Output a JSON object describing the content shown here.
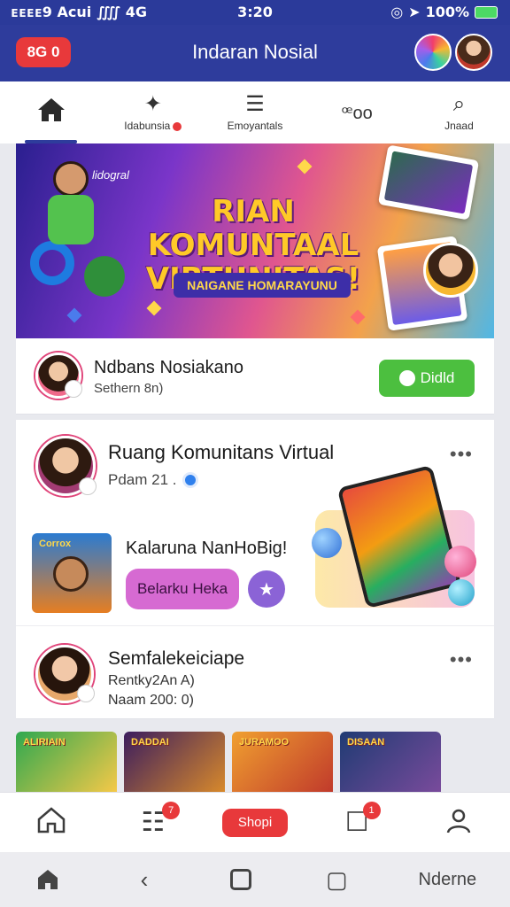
{
  "status_bar": {
    "carrier": "ᴇᴇᴇᴇ9 Acui",
    "network": "4G",
    "time": "3:20",
    "battery": "100%"
  },
  "header": {
    "notif_pill": "8G 0",
    "title": "Indaran Nosial"
  },
  "top_tabs": [
    {
      "label": "",
      "icon": "home-icon"
    },
    {
      "label": "Idabunsia",
      "icon": "puzzle-icon"
    },
    {
      "label": "Emoyantals",
      "icon": "stack-icon"
    },
    {
      "label": "ꟹoo",
      "icon": "chat-icon"
    },
    {
      "label": "Jnaad",
      "icon": "search-icon"
    }
  ],
  "banner": {
    "brand": "lidogral",
    "headline": "RIAN KOMUNTAAL VIRTUNITAS!",
    "subhead": "NAIGANE HOMARAYUNU"
  },
  "join_row": {
    "name": "Ndbans Nosiakano",
    "subtitle": "Sethern 8n)",
    "button": "Didld"
  },
  "post": {
    "title": "Ruang Komunitans Virtual",
    "meta": "Pdam 21 .",
    "thumb_label": "Corrox",
    "promo": "Kalaruna NanHoBig!",
    "pill_button": "Belarku Heka",
    "second_title": "Semfalekeiciape",
    "second_line1": "Rentky2An A)",
    "second_line2": "Naam 200: 0)"
  },
  "strip_tiles": [
    {
      "label": "ALIRIAIN",
      "colors": [
        "#2fa84f",
        "#f7c948"
      ]
    },
    {
      "label": "DADDAI",
      "colors": [
        "#3b1d5e",
        "#d98a2b"
      ]
    },
    {
      "label": "JURAMOO",
      "colors": [
        "#f0a030",
        "#c0392b"
      ]
    },
    {
      "label": "DISAAN",
      "colors": [
        "#1f3b73",
        "#7a4b9c"
      ]
    }
  ],
  "bottom_nav": [
    {
      "icon": "home-icon",
      "badge": ""
    },
    {
      "icon": "news-icon",
      "badge": "7"
    },
    {
      "icon": "shop-button",
      "label": "Shopi"
    },
    {
      "icon": "activity-icon",
      "badge": "1"
    },
    {
      "icon": "profile-icon",
      "badge": ""
    }
  ],
  "system_nav": {
    "right_label": "Nderne"
  },
  "colors": {
    "primary": "#2e3c9c",
    "accent_red": "#e8393b",
    "join_green": "#4cbf3f",
    "pill_pink": "#d66ad2"
  }
}
